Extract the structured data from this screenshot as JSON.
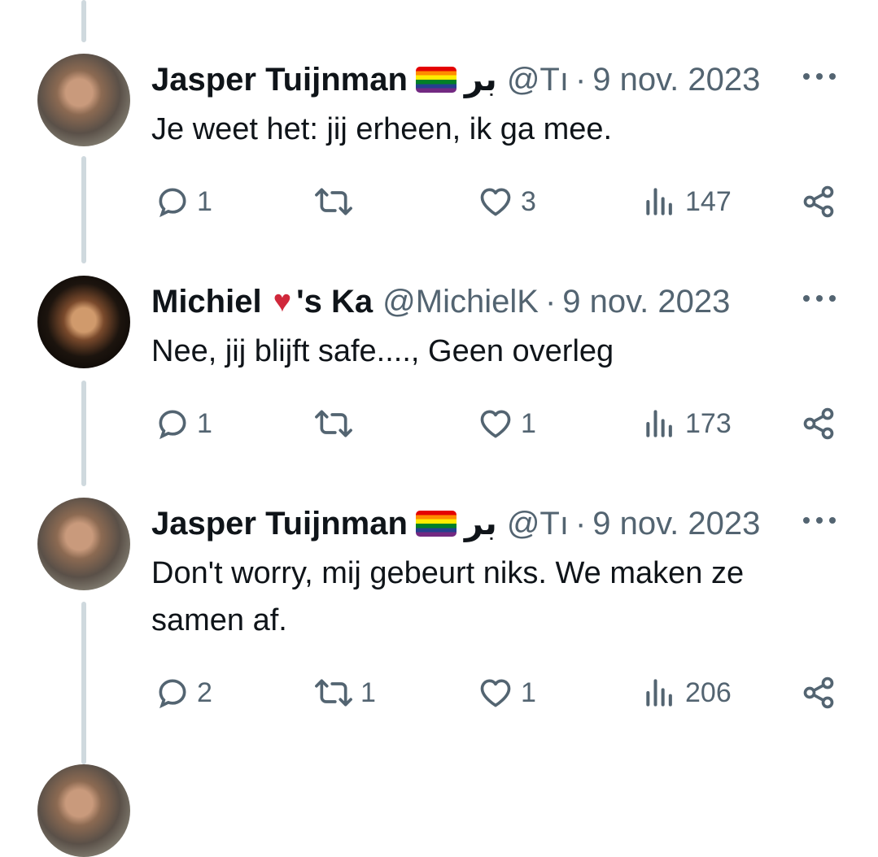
{
  "tweets": [
    {
      "name": "Jasper Tuijnman",
      "flag": "rainbow-flag",
      "arabic": "بر",
      "heart": "",
      "extra": "",
      "handle": "@Tı",
      "date": "9 nov. 2023",
      "text": "Je weet het: jij erheen, ik ga mee.",
      "replies": "1",
      "retweets": "",
      "likes": "3",
      "views": "147"
    },
    {
      "name": "Michiel",
      "flag": "",
      "arabic": "",
      "heart": "♥",
      "extra": "'s Ka",
      "handle": "@MichielK",
      "date": "9 nov. 2023",
      "text": "Nee, jij blijft safe...., Geen overleg",
      "replies": "1",
      "retweets": "",
      "likes": "1",
      "views": "173"
    },
    {
      "name": "Jasper Tuijnman",
      "flag": "rainbow-flag",
      "arabic": "بر",
      "heart": "",
      "extra": "",
      "handle": "@Tı",
      "date": "9 nov. 2023",
      "text": "Don't worry, mij gebeurt niks. We maken ze samen af.",
      "replies": "2",
      "retweets": "1",
      "likes": "1",
      "views": "206"
    }
  ],
  "colors": {
    "text": "#0f1419",
    "secondary": "#536471",
    "thread_line": "#cfd9de",
    "heart": "#d0283b"
  }
}
